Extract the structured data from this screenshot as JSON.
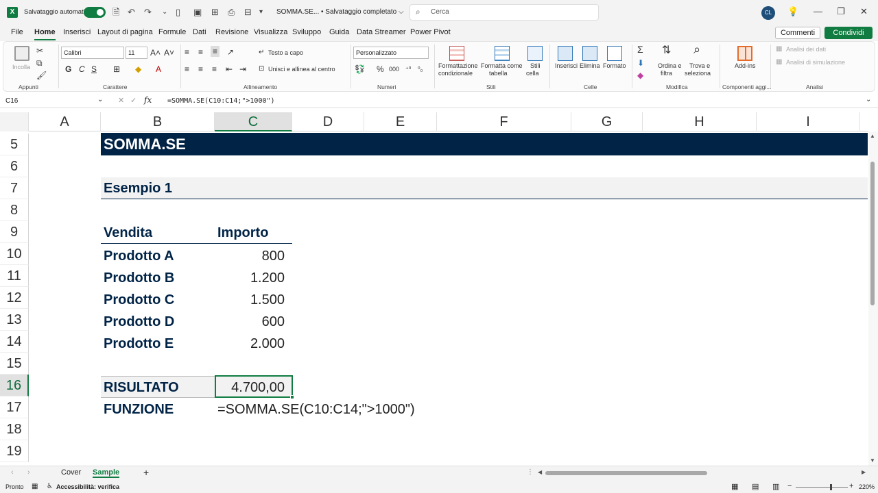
{
  "titlebar": {
    "autosave_label": "Salvataggio automatico",
    "doc_title": "SOMMA.SE... • Salvataggio completato ⌵",
    "search_placeholder": "Cerca",
    "avatar": "CL"
  },
  "menu": {
    "tabs": [
      "File",
      "Home",
      "Inserisci",
      "Layout di pagina",
      "Formule",
      "Dati",
      "Revisione",
      "Visualizza",
      "Sviluppo",
      "Guida",
      "Data Streamer",
      "Power Pivot"
    ],
    "active": "Home",
    "comments": "Commenti",
    "share": "Condividi"
  },
  "ribbon": {
    "clipboard": {
      "paste": "Incolla",
      "group": "Appunti"
    },
    "font": {
      "name": "Calibri",
      "size": "11",
      "bold": "G",
      "italic": "C",
      "underline": "S",
      "group": "Carattere"
    },
    "alignment": {
      "wrap": "Testo a capo",
      "merge": "Unisci e allinea al centro",
      "group": "Allineamento"
    },
    "number": {
      "format": "Personalizzato",
      "group": "Numeri"
    },
    "styles": {
      "cond1": "Formattazione",
      "cond2": "condizionale",
      "table1": "Formatta come",
      "table2": "tabella",
      "cell1": "Stili",
      "cell2": "cella",
      "group": "Stili"
    },
    "cells": {
      "insert": "Inserisci",
      "delete": "Elimina",
      "format": "Formato",
      "group": "Celle"
    },
    "edit": {
      "sort1": "Ordina e",
      "sort2": "filtra",
      "find1": "Trova e",
      "find2": "seleziona",
      "group": "Modifica"
    },
    "addins": {
      "label": "Add-ins",
      "group": "Componenti aggi..."
    },
    "analysis": {
      "data": "Analisi dei dati",
      "whatif": "Analisi di simulazione",
      "group": "Analisi"
    }
  },
  "formulabar": {
    "namebox": "C16",
    "formula": "=SOMMA.SE(C10:C14;\">1000\")"
  },
  "grid": {
    "columns": [
      "A",
      "B",
      "C",
      "D",
      "E",
      "F",
      "G",
      "H",
      "I"
    ],
    "selected_column": "C",
    "rows": [
      "5",
      "6",
      "7",
      "8",
      "9",
      "10",
      "11",
      "12",
      "13",
      "14",
      "15",
      "16",
      "17",
      "18",
      "19"
    ],
    "selected_row": "16",
    "banner": "SOMMA.SE",
    "example": "Esempio 1",
    "header": {
      "b": "Vendita",
      "c": "Importo"
    },
    "data": [
      {
        "product": "Prodotto A",
        "amount": "800"
      },
      {
        "product": "Prodotto B",
        "amount": "1.200"
      },
      {
        "product": "Prodotto C",
        "amount": "1.500"
      },
      {
        "product": "Prodotto D",
        "amount": "600"
      },
      {
        "product": "Prodotto E",
        "amount": "2.000"
      }
    ],
    "result_label": "RISULTATO",
    "result_value": "4.700,00",
    "function_label": "FUNZIONE",
    "function_text": "=SOMMA.SE(C10:C14;\">1000\")"
  },
  "sheets": {
    "tabs": [
      "Cover",
      "Sample"
    ],
    "active": "Sample"
  },
  "status": {
    "ready": "Pronto",
    "accessibility": "Accessibilità: verifica",
    "zoom": "220%"
  },
  "colors": {
    "accent": "#107c41",
    "navy": "#002346"
  }
}
